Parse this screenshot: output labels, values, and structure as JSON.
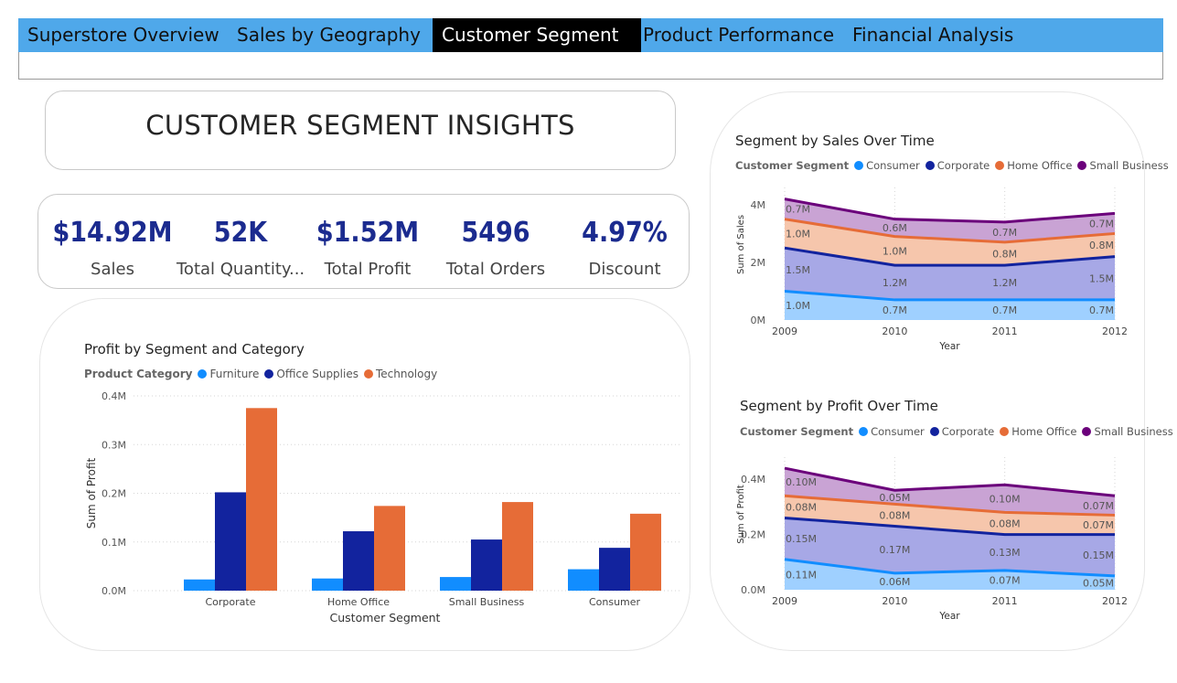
{
  "nav": {
    "tabs": [
      {
        "label": "Superstore Overview"
      },
      {
        "label": "Sales by Geography"
      },
      {
        "label": "Customer Segment"
      },
      {
        "label": "Product Performance"
      },
      {
        "label": "Financial Analysis"
      }
    ],
    "active_tab": "Customer Segment"
  },
  "page_title": "CUSTOMER SEGMENT INSIGHTS",
  "kpis": [
    {
      "value": "$14.92M",
      "label": "Sales"
    },
    {
      "value": "52K",
      "label": "Total Quantity..."
    },
    {
      "value": "$1.52M",
      "label": "Total Profit"
    },
    {
      "value": "5496",
      "label": "Total Orders"
    },
    {
      "value": "4.97%",
      "label": "Discount"
    }
  ],
  "colors": {
    "accent_nav": "#4fa8ea",
    "kpi_value": "#1b2b8f",
    "consumer": "#118dff",
    "corporate": "#12239e",
    "home_office": "#e66c37",
    "small_business": "#6b007b",
    "furniture": "#118dff",
    "office_supplies": "#12239e",
    "technology": "#e66c37"
  },
  "chart_data": [
    {
      "type": "bar",
      "title": "Profit by Segment and Category",
      "legend_title": "Product Category",
      "xlabel": "Customer Segment",
      "ylabel": "Sum of Profit",
      "yticks": [
        "0.0M",
        "0.1M",
        "0.2M",
        "0.3M",
        "0.4M"
      ],
      "ylim": [
        0,
        0.4
      ],
      "categories": [
        "Corporate",
        "Home Office",
        "Small Business",
        "Consumer"
      ],
      "series": [
        {
          "name": "Furniture",
          "values": [
            0.023,
            0.025,
            0.028,
            0.044
          ]
        },
        {
          "name": "Office Supplies",
          "values": [
            0.202,
            0.122,
            0.105,
            0.088
          ]
        },
        {
          "name": "Technology",
          "values": [
            0.375,
            0.174,
            0.182,
            0.158
          ]
        }
      ],
      "grid": true,
      "legend_placement": "top-left"
    },
    {
      "type": "area",
      "stacked": true,
      "title": "Segment by Sales Over Time",
      "legend_title": "Customer Segment",
      "xlabel": "Year",
      "ylabel": "Sum of Sales",
      "yticks": [
        "0M",
        "2M",
        "4M"
      ],
      "ylim": [
        0,
        4.6
      ],
      "x": [
        "2009",
        "2010",
        "2011",
        "2012"
      ],
      "series": [
        {
          "name": "Consumer",
          "values": [
            1.0,
            0.7,
            0.7,
            0.7
          ],
          "labels": [
            "1.0M",
            "0.7M",
            "0.7M",
            "0.7M"
          ]
        },
        {
          "name": "Corporate",
          "values": [
            1.5,
            1.2,
            1.2,
            1.5
          ],
          "labels": [
            "1.5M",
            "1.2M",
            "1.2M",
            "1.5M"
          ]
        },
        {
          "name": "Home Office",
          "values": [
            1.0,
            1.0,
            0.8,
            0.8
          ],
          "labels": [
            "1.0M",
            "1.0M",
            "0.8M",
            "0.8M"
          ]
        },
        {
          "name": "Small Business",
          "values": [
            0.7,
            0.6,
            0.7,
            0.7
          ],
          "labels": [
            "0.7M",
            "0.6M",
            "0.7M",
            "0.7M"
          ]
        }
      ],
      "grid": true,
      "legend_placement": "top-left"
    },
    {
      "type": "area",
      "stacked": true,
      "title": "Segment by Profit Over Time",
      "legend_title": "Customer Segment",
      "xlabel": "Year",
      "ylabel": "Sum of Profit",
      "yticks": [
        "0.0M",
        "0.2M",
        "0.4M"
      ],
      "ylim": [
        0,
        0.48
      ],
      "x": [
        "2009",
        "2010",
        "2011",
        "2012"
      ],
      "series": [
        {
          "name": "Consumer",
          "values": [
            0.11,
            0.06,
            0.07,
            0.05
          ],
          "labels": [
            "0.11M",
            "0.06M",
            "0.07M",
            "0.05M"
          ]
        },
        {
          "name": "Corporate",
          "values": [
            0.15,
            0.17,
            0.13,
            0.15
          ],
          "labels": [
            "0.15M",
            "0.17M",
            "0.13M",
            "0.15M"
          ]
        },
        {
          "name": "Home Office",
          "values": [
            0.08,
            0.08,
            0.08,
            0.07
          ],
          "labels": [
            "0.08M",
            "0.08M",
            "0.08M",
            "0.07M"
          ]
        },
        {
          "name": "Small Business",
          "values": [
            0.1,
            0.05,
            0.1,
            0.07
          ],
          "labels": [
            "0.10M",
            "0.05M",
            "0.10M",
            "0.07M"
          ]
        }
      ],
      "grid": true,
      "legend_placement": "top-left"
    }
  ]
}
